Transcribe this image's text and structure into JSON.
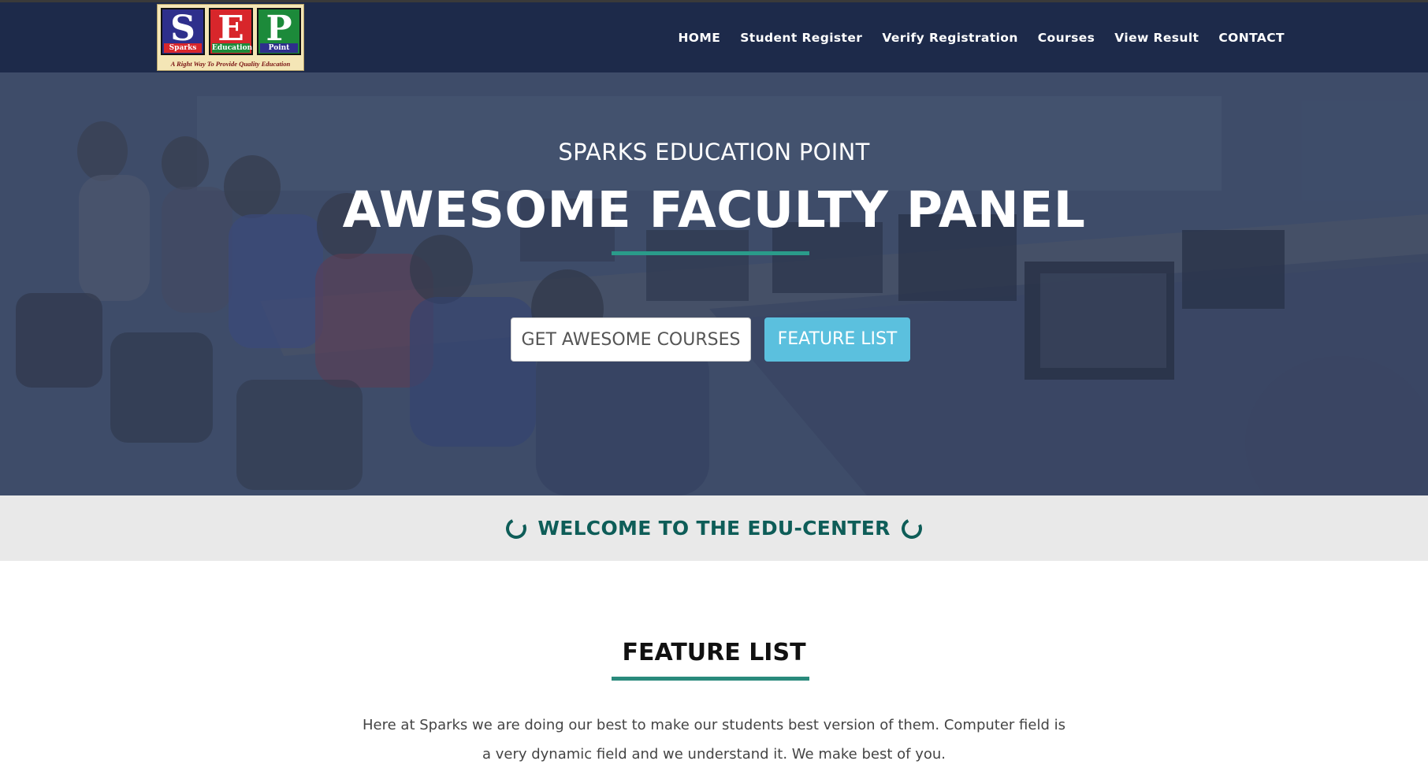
{
  "logo": {
    "letters": [
      "S",
      "E",
      "P"
    ],
    "captions": [
      "Sparks",
      "Education",
      "Point"
    ],
    "tagline": "A Right Way To Provide Quality Education",
    "colors": [
      "#2e2f8c",
      "#d8262b",
      "#1c8a3a"
    ]
  },
  "nav": {
    "items": [
      {
        "label": "HOME"
      },
      {
        "label": "Student Register"
      },
      {
        "label": "Verify Registration"
      },
      {
        "label": "Courses"
      },
      {
        "label": "View Result"
      },
      {
        "label": "CONTACT"
      }
    ]
  },
  "hero": {
    "subtitle": "SPARKS EDUCATION POINT",
    "title": "AWESOME FACULTY PANEL",
    "primary_button": "GET AWESOME COURSES",
    "secondary_button": "FEATURE LIST"
  },
  "welcome": {
    "text": "WELCOME TO THE EDU-CENTER",
    "left_icon": "spinner-ring-icon",
    "right_icon": "spinner-ring-icon"
  },
  "features": {
    "title": "FEATURE LIST",
    "description": "Here at Sparks we are doing our best to make our students best version of them. Computer field is a very dynamic field and we understand it. We make best of you."
  },
  "colors": {
    "navbar": "#1d2a4a",
    "accent_teal": "#2a9b8a",
    "button_blue": "#5bc0de",
    "welcome_text": "#0e5d58"
  }
}
